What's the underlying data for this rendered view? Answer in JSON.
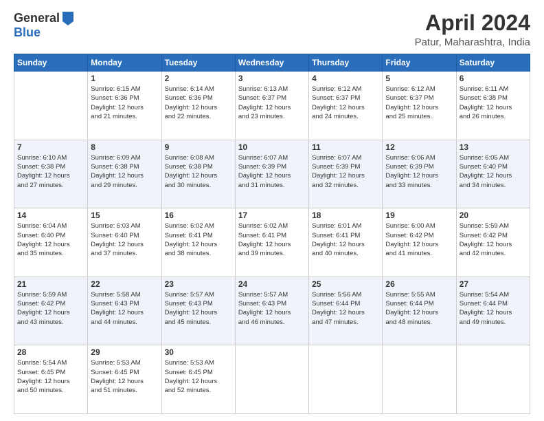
{
  "logo": {
    "general": "General",
    "blue": "Blue"
  },
  "title": "April 2024",
  "location": "Patur, Maharashtra, India",
  "days_header": [
    "Sunday",
    "Monday",
    "Tuesday",
    "Wednesday",
    "Thursday",
    "Friday",
    "Saturday"
  ],
  "weeks": [
    [
      {
        "day": "",
        "info": ""
      },
      {
        "day": "1",
        "info": "Sunrise: 6:15 AM\nSunset: 6:36 PM\nDaylight: 12 hours\nand 21 minutes."
      },
      {
        "day": "2",
        "info": "Sunrise: 6:14 AM\nSunset: 6:36 PM\nDaylight: 12 hours\nand 22 minutes."
      },
      {
        "day": "3",
        "info": "Sunrise: 6:13 AM\nSunset: 6:37 PM\nDaylight: 12 hours\nand 23 minutes."
      },
      {
        "day": "4",
        "info": "Sunrise: 6:12 AM\nSunset: 6:37 PM\nDaylight: 12 hours\nand 24 minutes."
      },
      {
        "day": "5",
        "info": "Sunrise: 6:12 AM\nSunset: 6:37 PM\nDaylight: 12 hours\nand 25 minutes."
      },
      {
        "day": "6",
        "info": "Sunrise: 6:11 AM\nSunset: 6:38 PM\nDaylight: 12 hours\nand 26 minutes."
      }
    ],
    [
      {
        "day": "7",
        "info": "Sunrise: 6:10 AM\nSunset: 6:38 PM\nDaylight: 12 hours\nand 27 minutes."
      },
      {
        "day": "8",
        "info": "Sunrise: 6:09 AM\nSunset: 6:38 PM\nDaylight: 12 hours\nand 29 minutes."
      },
      {
        "day": "9",
        "info": "Sunrise: 6:08 AM\nSunset: 6:38 PM\nDaylight: 12 hours\nand 30 minutes."
      },
      {
        "day": "10",
        "info": "Sunrise: 6:07 AM\nSunset: 6:39 PM\nDaylight: 12 hours\nand 31 minutes."
      },
      {
        "day": "11",
        "info": "Sunrise: 6:07 AM\nSunset: 6:39 PM\nDaylight: 12 hours\nand 32 minutes."
      },
      {
        "day": "12",
        "info": "Sunrise: 6:06 AM\nSunset: 6:39 PM\nDaylight: 12 hours\nand 33 minutes."
      },
      {
        "day": "13",
        "info": "Sunrise: 6:05 AM\nSunset: 6:40 PM\nDaylight: 12 hours\nand 34 minutes."
      }
    ],
    [
      {
        "day": "14",
        "info": "Sunrise: 6:04 AM\nSunset: 6:40 PM\nDaylight: 12 hours\nand 35 minutes."
      },
      {
        "day": "15",
        "info": "Sunrise: 6:03 AM\nSunset: 6:40 PM\nDaylight: 12 hours\nand 37 minutes."
      },
      {
        "day": "16",
        "info": "Sunrise: 6:02 AM\nSunset: 6:41 PM\nDaylight: 12 hours\nand 38 minutes."
      },
      {
        "day": "17",
        "info": "Sunrise: 6:02 AM\nSunset: 6:41 PM\nDaylight: 12 hours\nand 39 minutes."
      },
      {
        "day": "18",
        "info": "Sunrise: 6:01 AM\nSunset: 6:41 PM\nDaylight: 12 hours\nand 40 minutes."
      },
      {
        "day": "19",
        "info": "Sunrise: 6:00 AM\nSunset: 6:42 PM\nDaylight: 12 hours\nand 41 minutes."
      },
      {
        "day": "20",
        "info": "Sunrise: 5:59 AM\nSunset: 6:42 PM\nDaylight: 12 hours\nand 42 minutes."
      }
    ],
    [
      {
        "day": "21",
        "info": "Sunrise: 5:59 AM\nSunset: 6:42 PM\nDaylight: 12 hours\nand 43 minutes."
      },
      {
        "day": "22",
        "info": "Sunrise: 5:58 AM\nSunset: 6:43 PM\nDaylight: 12 hours\nand 44 minutes."
      },
      {
        "day": "23",
        "info": "Sunrise: 5:57 AM\nSunset: 6:43 PM\nDaylight: 12 hours\nand 45 minutes."
      },
      {
        "day": "24",
        "info": "Sunrise: 5:57 AM\nSunset: 6:43 PM\nDaylight: 12 hours\nand 46 minutes."
      },
      {
        "day": "25",
        "info": "Sunrise: 5:56 AM\nSunset: 6:44 PM\nDaylight: 12 hours\nand 47 minutes."
      },
      {
        "day": "26",
        "info": "Sunrise: 5:55 AM\nSunset: 6:44 PM\nDaylight: 12 hours\nand 48 minutes."
      },
      {
        "day": "27",
        "info": "Sunrise: 5:54 AM\nSunset: 6:44 PM\nDaylight: 12 hours\nand 49 minutes."
      }
    ],
    [
      {
        "day": "28",
        "info": "Sunrise: 5:54 AM\nSunset: 6:45 PM\nDaylight: 12 hours\nand 50 minutes."
      },
      {
        "day": "29",
        "info": "Sunrise: 5:53 AM\nSunset: 6:45 PM\nDaylight: 12 hours\nand 51 minutes."
      },
      {
        "day": "30",
        "info": "Sunrise: 5:53 AM\nSunset: 6:45 PM\nDaylight: 12 hours\nand 52 minutes."
      },
      {
        "day": "",
        "info": ""
      },
      {
        "day": "",
        "info": ""
      },
      {
        "day": "",
        "info": ""
      },
      {
        "day": "",
        "info": ""
      }
    ]
  ]
}
